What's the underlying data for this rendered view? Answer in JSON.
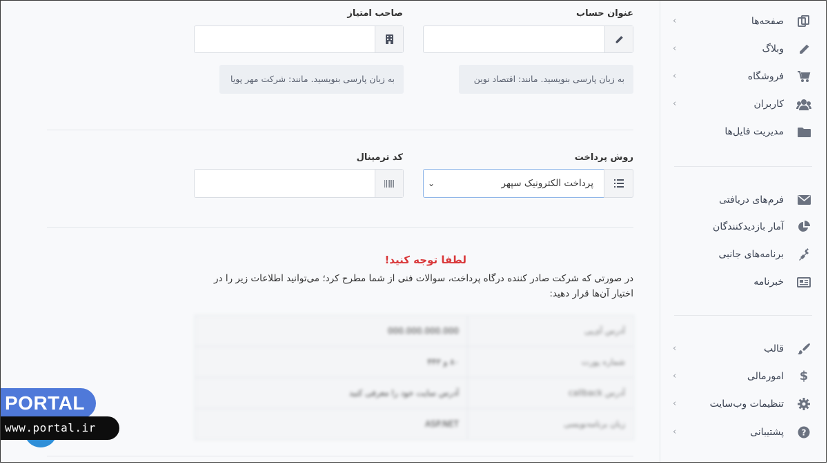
{
  "sidebar": {
    "group1": [
      {
        "label": "صفحه‌ها",
        "icon": "pages-icon",
        "has_submenu": true
      },
      {
        "label": "وبلاگ",
        "icon": "pencil-icon",
        "has_submenu": true
      },
      {
        "label": "فروشگاه",
        "icon": "cart-icon",
        "has_submenu": true
      },
      {
        "label": "کاربران",
        "icon": "users-icon",
        "has_submenu": true
      },
      {
        "label": "مدیریت فایل‌ها",
        "icon": "folder-icon",
        "has_submenu": false
      }
    ],
    "group2": [
      {
        "label": "فرم‌های دریافتی",
        "icon": "envelope-icon",
        "has_submenu": false
      },
      {
        "label": "آمار بازدیدکنندگان",
        "icon": "pie-chart-icon",
        "has_submenu": false
      },
      {
        "label": "برنامه‌های جانبی",
        "icon": "plug-icon",
        "has_submenu": false
      },
      {
        "label": "خبرنامه",
        "icon": "newspaper-icon",
        "has_submenu": false
      }
    ],
    "group3": [
      {
        "label": "قالب",
        "icon": "brush-icon",
        "has_submenu": true
      },
      {
        "label": "امورمالی",
        "icon": "dollar-icon",
        "has_submenu": true
      },
      {
        "label": "تنظیمات وب‌سایت",
        "icon": "gear-icon",
        "has_submenu": true
      },
      {
        "label": "پشتیبانی",
        "icon": "question-icon",
        "has_submenu": true
      }
    ],
    "chevron": "‹"
  },
  "form": {
    "account_title": {
      "label": "عنوان حساب",
      "value": "",
      "help": "به زبان پارسی بنویسید. مانند: اقتصاد نوین"
    },
    "owner": {
      "label": "صاحب امتیاز",
      "value": "",
      "help": "به زبان پارسی بنویسید. مانند: شرکت مهر پویا"
    },
    "payment_method": {
      "label": "روش پرداخت",
      "selected": "پرداخت الکترونیک سپهر",
      "caret": "⌄"
    },
    "terminal_code": {
      "label": "کد ترمینال",
      "value": ""
    }
  },
  "notice": {
    "title": "لطفا توجه کنید!",
    "body": "در صورتی که شرکت صادر کننده درگاه پرداخت، سوالات فنی از شما مطرح کرد؛ می‌توانید اطلاعات زیر را در اختیار آن‌ها قرار دهید:"
  },
  "info_table": [
    {
      "key": "آدرس آی‌پی",
      "value": "000.000.000.000"
    },
    {
      "key": "شماره پورت",
      "value": "۸۰ و ۴۴۳"
    },
    {
      "key": "آدرس callback",
      "value": "آدرس سایت خود را معرفی کنید"
    },
    {
      "key": "زبان برنامه‌نویسی",
      "value": "ASP.NET"
    }
  ],
  "watermark": {
    "brand": "PORTAL",
    "url": "www.portal.ir"
  }
}
